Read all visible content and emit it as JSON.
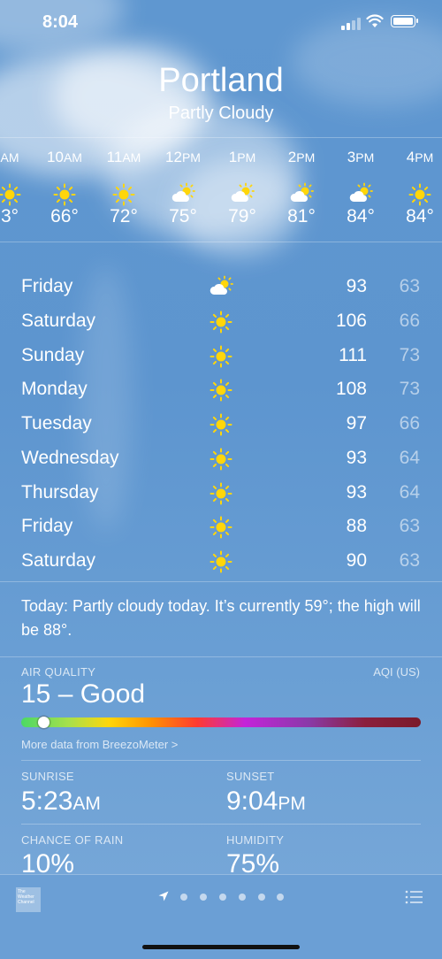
{
  "status_bar": {
    "time": "8:04"
  },
  "location": {
    "city": "Portland",
    "condition": "Partly Cloudy"
  },
  "hourly": [
    {
      "hour": "",
      "period": "AM",
      "icon": "sun-icon",
      "temp": "3°"
    },
    {
      "hour": "10",
      "period": "AM",
      "icon": "sun-icon",
      "temp": "66°"
    },
    {
      "hour": "11",
      "period": "AM",
      "icon": "sun-icon",
      "temp": "72°"
    },
    {
      "hour": "12",
      "period": "PM",
      "icon": "partly-cloudy-icon",
      "temp": "75°"
    },
    {
      "hour": "1",
      "period": "PM",
      "icon": "partly-cloudy-icon",
      "temp": "79°"
    },
    {
      "hour": "2",
      "period": "PM",
      "icon": "partly-cloudy-icon",
      "temp": "81°"
    },
    {
      "hour": "3",
      "period": "PM",
      "icon": "partly-cloudy-icon",
      "temp": "84°"
    },
    {
      "hour": "4",
      "period": "PM",
      "icon": "sun-icon",
      "temp": "84°"
    }
  ],
  "daily": [
    {
      "day": "Friday",
      "icon": "partly-cloudy-icon",
      "high": "93",
      "low": "63"
    },
    {
      "day": "Saturday",
      "icon": "sun-icon",
      "high": "106",
      "low": "66"
    },
    {
      "day": "Sunday",
      "icon": "sun-icon",
      "high": "111",
      "low": "73"
    },
    {
      "day": "Monday",
      "icon": "sun-icon",
      "high": "108",
      "low": "73"
    },
    {
      "day": "Tuesday",
      "icon": "sun-icon",
      "high": "97",
      "low": "66"
    },
    {
      "day": "Wednesday",
      "icon": "sun-icon",
      "high": "93",
      "low": "64"
    },
    {
      "day": "Thursday",
      "icon": "sun-icon",
      "high": "93",
      "low": "64"
    },
    {
      "day": "Friday",
      "icon": "sun-icon",
      "high": "88",
      "low": "63"
    },
    {
      "day": "Saturday",
      "icon": "sun-icon",
      "high": "90",
      "low": "63"
    }
  ],
  "summary": "Today: Partly cloudy today. It’s currently 59°; the high will be 88°.",
  "air_quality": {
    "title": "AIR QUALITY",
    "scale": "AQI (US)",
    "value": "15 – Good",
    "link": "More data from BreezoMeter >",
    "gradient_colors": [
      "#4cd964",
      "#ffd60a",
      "#ff9500",
      "#ff3b30",
      "#c324d9",
      "#7a1a2a"
    ]
  },
  "details": [
    {
      "label": "SUNRISE",
      "value": "5:23",
      "unit": "AM"
    },
    {
      "label": "SUNSET",
      "value": "9:04",
      "unit": "PM"
    },
    {
      "label": "CHANCE OF RAIN",
      "value": "10%",
      "unit": ""
    },
    {
      "label": "HUMIDITY",
      "value": "75%",
      "unit": ""
    }
  ],
  "bottom_bar": {
    "logo_text": "The Weather Channel",
    "page_count": 6,
    "current_page_icon": "location-arrow-icon",
    "list_icon": "list-icon"
  },
  "colors": {
    "sky": "#5f97d0",
    "sun": "#ffd60a",
    "bottom_bar": "#6b9fd5"
  }
}
